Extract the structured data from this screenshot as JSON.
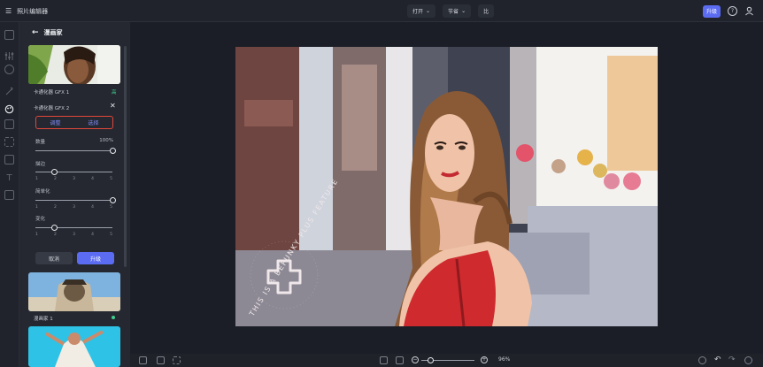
{
  "app": {
    "title": "照片编辑器"
  },
  "toolbar": {
    "open_label": "打开",
    "save_label": "节省",
    "compare_label": "比",
    "upgrade_label": "升级",
    "help_glyph": "?"
  },
  "panel": {
    "title": "漫画家",
    "presets": [
      {
        "label": "卡通化器 GFX 1",
        "badge": "高"
      },
      {
        "label": "漫画家 1"
      }
    ],
    "active_preset": "卡通化器 GFX 2",
    "tabs": {
      "adjust": "调整",
      "select": "选择"
    },
    "sliders": [
      {
        "label": "数量",
        "value": "100%",
        "fraction": 1.0
      },
      {
        "label": "描边",
        "fraction": 0.25
      },
      {
        "label": "简单化",
        "fraction": 1.0
      },
      {
        "label": "变化",
        "fraction": 0.25
      }
    ],
    "tick_labels": [
      "1",
      "2",
      "3",
      "4",
      "5"
    ],
    "cancel_label": "取消",
    "apply_label": "升级"
  },
  "canvas": {
    "watermark_text": "THIS IS A BEFUNKY PLUS FEATURE"
  },
  "bottombar": {
    "zoom_value": "96%",
    "minus_glyph": "−",
    "plus_glyph": "+"
  },
  "colors": {
    "accent": "#5b6cf2",
    "highlight": "#e0473b",
    "background": "#1b1e26",
    "panel": "#252830"
  }
}
